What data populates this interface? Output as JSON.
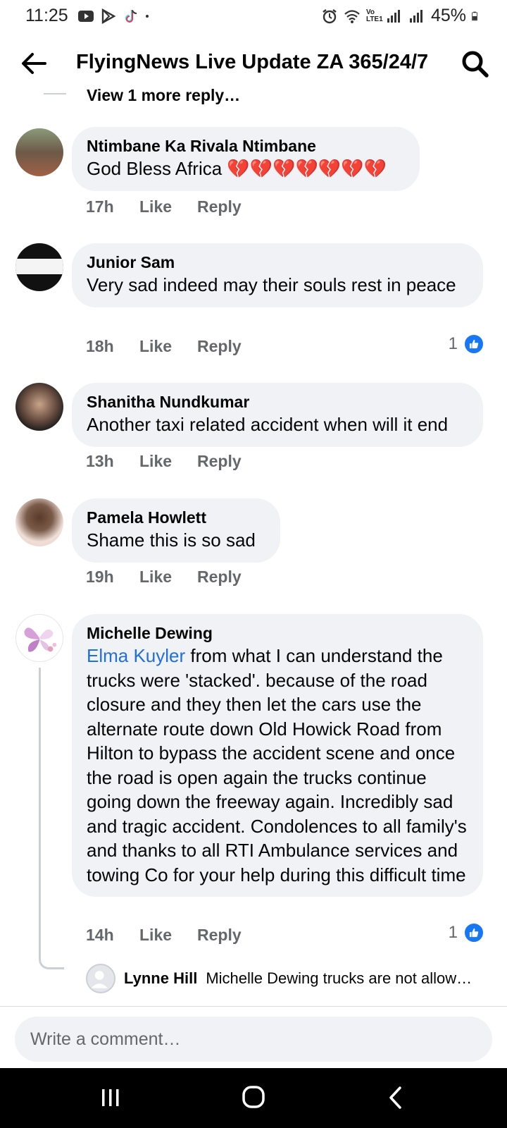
{
  "status_bar": {
    "time": "11:25",
    "battery": "45%",
    "volte": "Vo LTE1"
  },
  "header": {
    "title": "FlyingNews Live Update ZA 365/24/7"
  },
  "thread": {
    "more_replies": "View 1 more reply…",
    "comments": [
      {
        "name": "Ntimbane Ka Rivala Ntimbane",
        "text": "God Bless Africa 💔💔💔💔💔💔💔",
        "time": "17h",
        "like": "Like",
        "reply": "Reply"
      },
      {
        "name": "Junior Sam",
        "text": "Very sad indeed may their souls rest in peace",
        "time": "18h",
        "like": "Like",
        "reply": "Reply",
        "reactions": "1"
      },
      {
        "name": "Shanitha Nundkumar",
        "text": "Another taxi related accident when will it end",
        "time": "13h",
        "like": "Like",
        "reply": "Reply"
      },
      {
        "name": "Pamela Howlett",
        "text": "Shame this is so sad",
        "time": "19h",
        "like": "Like",
        "reply": "Reply"
      },
      {
        "name": "Michelle Dewing",
        "mention": "Elma Kuyler",
        "text": " from what I can understand the trucks were 'stacked'. because of the road closure and they then let the cars use the alternate route down Old Howick Road from Hilton to bypass the accident scene and once the road is open again the trucks continue going down the freeway again. Incredibly sad and tragic accident. Condolences to all family's and thanks to all RTI Ambulance services and towing Co for your help during this difficult time",
        "time": "14h",
        "like": "Like",
        "reply": "Reply",
        "reactions": "1"
      }
    ],
    "reply_preview": {
      "name": "Lynne Hill",
      "text": "Michelle Dewing trucks are not allow…"
    }
  },
  "compose": {
    "placeholder": "Write a comment…"
  },
  "colors": {
    "bubble": "#f0f2f5",
    "mention": "#216fdb",
    "like_blue": "#1877f2",
    "meta_gray": "#65676b"
  },
  "icons": [
    "youtube-icon",
    "play-store-icon",
    "tiktok-icon",
    "alarm-icon",
    "wifi-icon",
    "signal-icon",
    "battery-icon",
    "back-arrow-icon",
    "search-icon",
    "like-reaction-icon",
    "recents-icon",
    "home-icon",
    "nav-back-icon"
  ]
}
